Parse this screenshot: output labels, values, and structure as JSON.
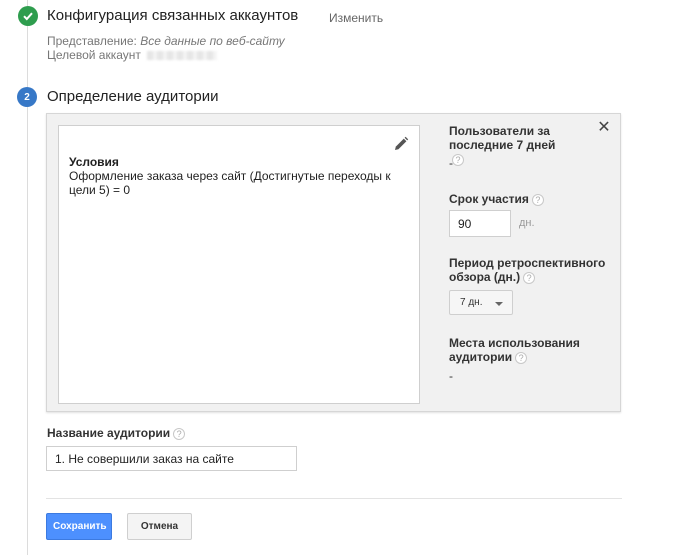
{
  "step1": {
    "title": "Конфигурация связанных аккаунтов",
    "edit_link": "Изменить",
    "view_label": "Представление: ",
    "view_value": "Все данные по веб-сайту",
    "target_account_label": "Целевой аккаунт"
  },
  "step2": {
    "number": "2",
    "title": "Определение аудитории"
  },
  "conditions": {
    "label": "Условия",
    "text": "Оформление заказа через сайт (Достигнутые переходы к цели 5) = 0"
  },
  "sidebar": {
    "users_label": "Пользователи за последние 7 дней",
    "users_value": "-",
    "duration_label": "Срок участия",
    "duration_value": "90",
    "duration_unit": "дн.",
    "lookback_label": "Период ретроспективного обзора (дн.)",
    "lookback_value": "7 дн.",
    "destinations_label": "Места использования аудитории",
    "destinations_value": "-"
  },
  "audience_name": {
    "label": "Название аудитории",
    "value": "1. Не совершили заказ на сайте"
  },
  "buttons": {
    "save": "Сохранить",
    "cancel": "Отмена"
  },
  "help_glyph": "?",
  "close_glyph": "✕",
  "colors": {
    "success_green": "#2e9d4e",
    "step_blue": "#3778c7",
    "primary_button": "#4d90fe"
  }
}
